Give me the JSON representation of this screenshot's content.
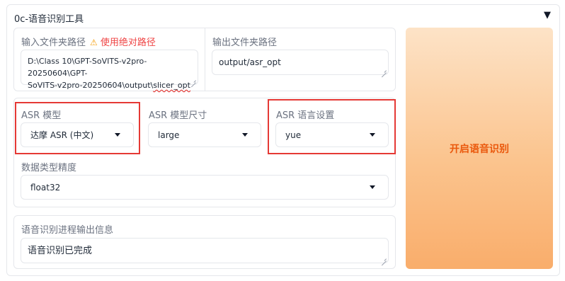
{
  "accordion": {
    "title": "0c-语音识别工具",
    "toggle_icon": "▼"
  },
  "input_path": {
    "label": "输入文件夹路径",
    "warning_icon": "⚠",
    "warning": "使用绝对路径",
    "value_line1": "D:\\Class 10\\GPT-SoVITS-v2pro-20250604\\GPT-",
    "value_line2_a": "SoVITS-v2pro-20250604\\output\\",
    "value_line2_b": "slicer_opt"
  },
  "output_path": {
    "label": "输出文件夹路径",
    "value": "output/asr_opt"
  },
  "asr_model": {
    "label": "ASR 模型",
    "value": "达摩 ASR (中文)"
  },
  "asr_size": {
    "label": "ASR 模型尺寸",
    "value": "large"
  },
  "asr_lang": {
    "label": "ASR 语言设置",
    "value": "yue"
  },
  "precision": {
    "label": "数据类型精度",
    "value": "float32"
  },
  "progress": {
    "label": "语音识别进程输出信息",
    "value": "语音识别已完成"
  },
  "run_button": {
    "label": "开启语音识别"
  },
  "colors": {
    "highlight": "#e53935",
    "button_text": "#ea580c",
    "warning": "#ef4444"
  }
}
